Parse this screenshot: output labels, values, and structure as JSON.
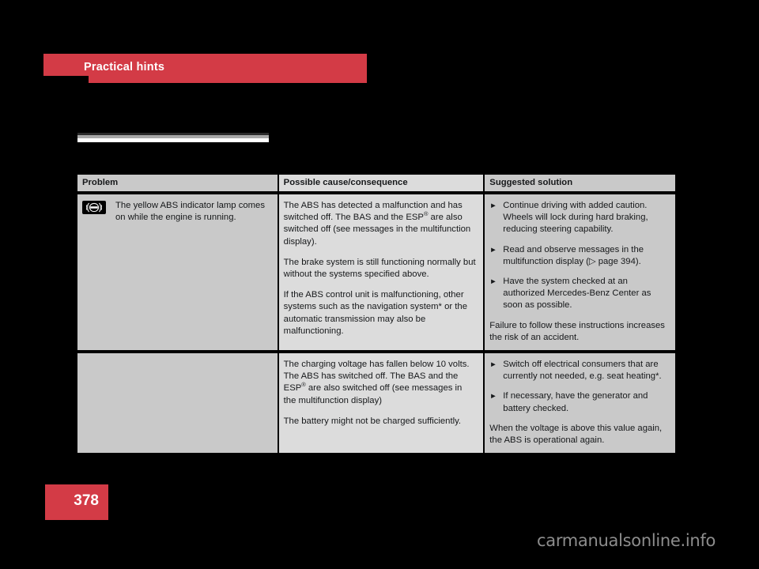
{
  "chapter": {
    "title": "Practical hints",
    "bar_color": "#d33b46"
  },
  "page_number": "378",
  "watermark": "carmanualsonline.info",
  "table": {
    "headers": {
      "problem": "Problem",
      "cause": "Possible cause/consequence",
      "solution": "Suggested solution"
    },
    "rows": [
      {
        "icon": "abs-warning-lamp-icon",
        "icon_label": "ABS",
        "problem": "The yellow ABS indicator lamp comes on while the engine is running.",
        "cause_paragraphs": [
          "The ABS has detected a malfunction and has switched off. The BAS and the ESP® are also switched off (see messages in the multifunction display).",
          "The brake system is still functioning normally but without the systems specified above.",
          "If the ABS control unit is malfunctioning, other systems such as the navigation system* or the automatic transmission may also be malfunctioning."
        ],
        "solution_bullets": [
          "Continue driving with added caution. Wheels will lock during hard braking, reducing steering capability.",
          "Read and observe messages in the multifunction display (▷ page 394).",
          "Have the system checked at an authorized Mercedes-Benz Center as soon as possible."
        ],
        "solution_note": "Failure to follow these instructions increases the risk of an accident."
      },
      {
        "icon": "",
        "icon_label": "",
        "problem": "",
        "cause_paragraphs": [
          "The charging voltage has fallen below 10 volts. The ABS has switched off. The BAS and the ESP® are also switched off (see messages in the multifunction display)",
          "The battery might not be charged sufficiently."
        ],
        "solution_bullets": [
          "Switch off electrical consumers that are currently not needed, e.g. seat heating*.",
          "If necessary, have the generator and battery checked."
        ],
        "solution_note": "When the voltage is above this value again, the ABS is operational again."
      }
    ]
  }
}
